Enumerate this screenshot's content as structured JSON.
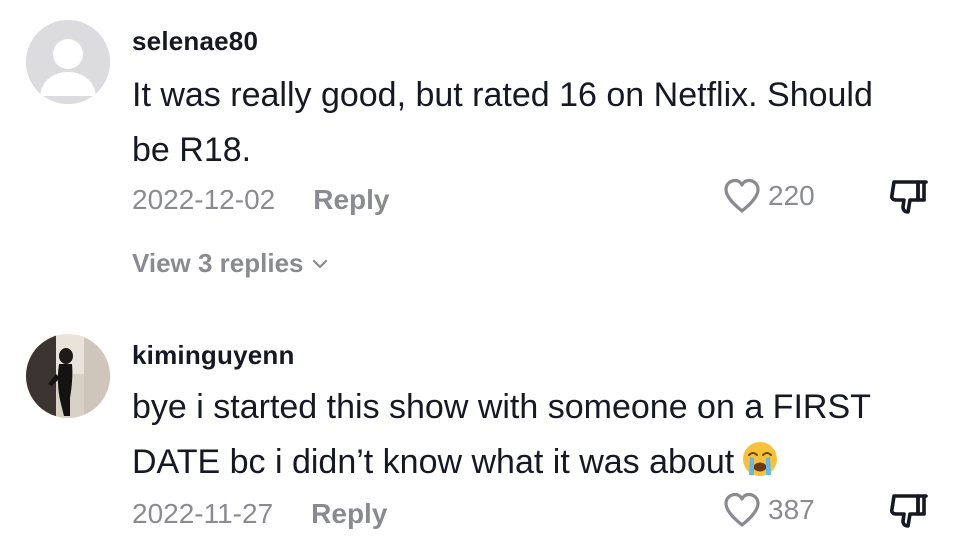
{
  "comments": [
    {
      "username": "selenae80",
      "text_line1": "It was really good, but rated 16 on Netflix. Should",
      "text_line2": "be R18.",
      "date": "2022-12-02",
      "reply_label": "Reply",
      "likes": "220",
      "view_replies": "View 3 replies",
      "avatar_icon": "default-user-avatar"
    },
    {
      "username": "kiminguyenn",
      "text_line1": "bye i started this show with someone on a FIRST",
      "text_line2": "DATE bc i didn’t know what it was about",
      "emoji": "loudly-crying-face",
      "date": "2022-11-27",
      "reply_label": "Reply",
      "likes": "387",
      "avatar_icon": "photo-avatar"
    }
  ],
  "icons": {
    "like": "heart-outline-icon",
    "dislike": "thumbs-down-icon",
    "expand": "chevron-down-icon"
  },
  "colors": {
    "text_primary": "#161823",
    "text_secondary": "#8a8b91",
    "avatar_placeholder": "#dcdcdf"
  }
}
